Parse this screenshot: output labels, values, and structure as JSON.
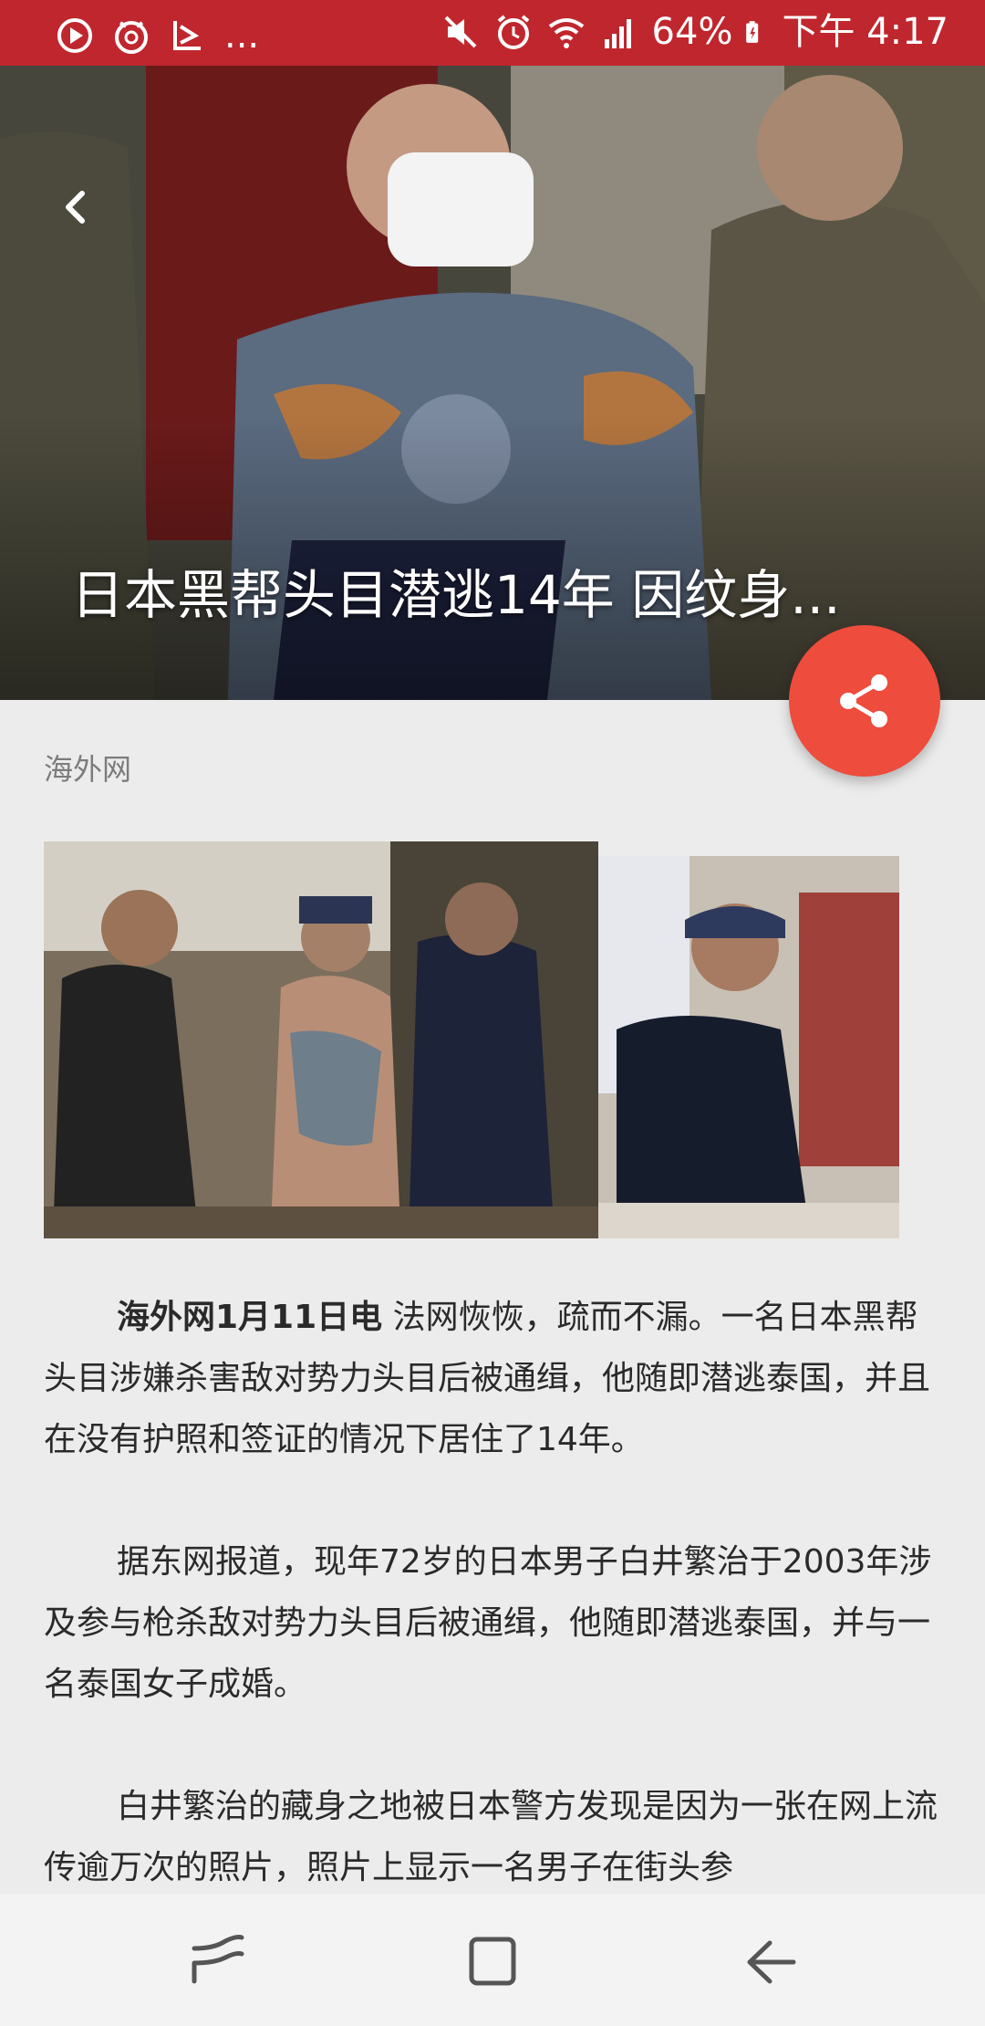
{
  "status_bar": {
    "battery": "64%",
    "time": "下午 4:17",
    "overflow": "...",
    "icons": [
      "play-icon",
      "timer-icon",
      "notification-icon",
      "mute-icon",
      "alarm-icon",
      "wifi-icon",
      "signal-icon",
      "battery-icon"
    ]
  },
  "hero": {
    "title": "日本黑帮头目潜逃14年 因纹身..."
  },
  "article": {
    "source": "海外网",
    "lead": "海外网1月11日电",
    "p1_rest": " 法网恢恢，疏而不漏。一名日本黑帮头目涉嫌杀害敌对势力头目后被通缉，他随即潜逃泰国，并且在没有护照和签证的情况下居住了14年。",
    "p2": "据东网报道，现年72岁的日本男子白井繁治于2003年涉及参与枪杀敌对势力头目后被通缉，他随即潜逃泰国，并与一名泰国女子成婚。",
    "p3": "白井繁治的藏身之地被日本警方发现是因为一张在网上流传逾万次的照片，照片上显示一名男子在街头参"
  },
  "colors": {
    "status_bar": "#c0262d",
    "fab": "#ee4c3c",
    "background": "#ececec"
  }
}
